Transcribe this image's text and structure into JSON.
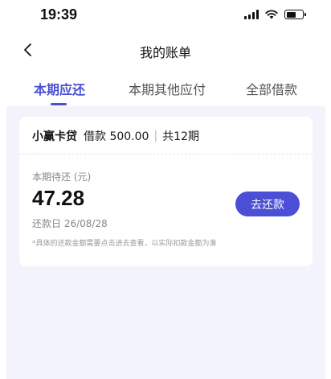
{
  "status_bar": {
    "time": "19:39"
  },
  "nav": {
    "title": "我的账单",
    "back_icon": "chevron-left-icon"
  },
  "tabs": [
    {
      "label": "本期应还",
      "active": true
    },
    {
      "label": "本期其他应付",
      "active": false
    },
    {
      "label": "全部借款",
      "active": false
    }
  ],
  "card": {
    "loan_name": "小赢卡贷",
    "loan_amount_text": "借款 500.00",
    "separator": "|",
    "periods_text": "共12期",
    "due_label": "本期待还 (元)",
    "due_amount": "47.28",
    "repay_date": "还款日 26/08/28",
    "repay_button": "去还款",
    "note": "*具体的还款金额需要点击进去查看，以实际扣款金额为准"
  },
  "colors": {
    "accent": "#4b4fd6",
    "background": "#f3f4fb"
  }
}
